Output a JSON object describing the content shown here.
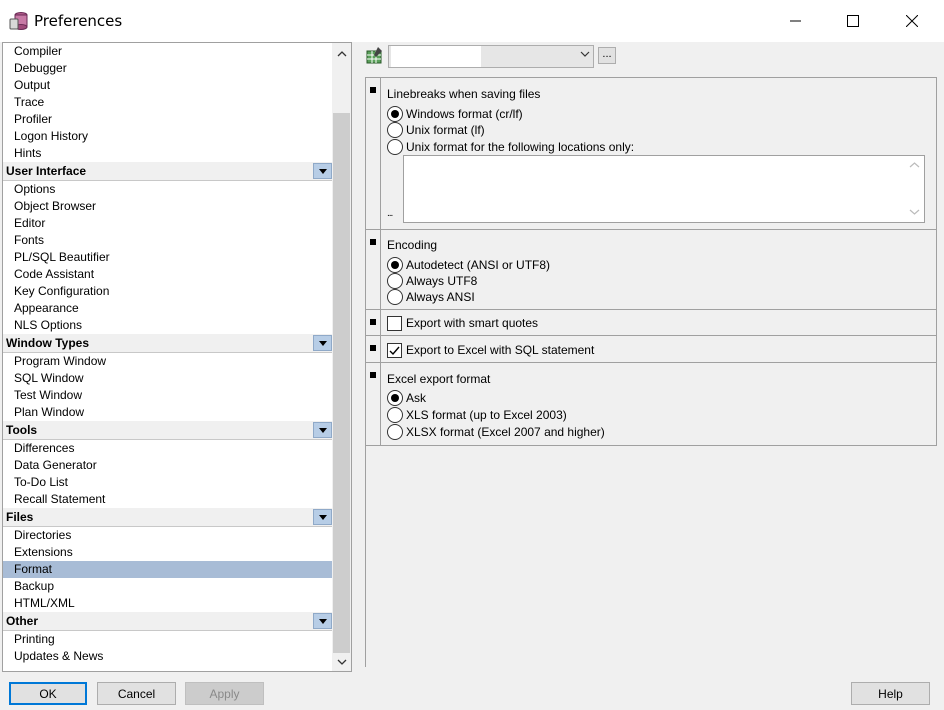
{
  "window": {
    "title": "Preferences",
    "icon": "database-icon"
  },
  "tree": {
    "groups": [
      {
        "header": null,
        "items": [
          "Compiler",
          "Debugger",
          "Output",
          "Trace",
          "Profiler",
          "Logon History",
          "Hints"
        ]
      },
      {
        "header": "User Interface",
        "items": [
          "Options",
          "Object Browser",
          "Editor",
          "Fonts",
          "PL/SQL Beautifier",
          "Code Assistant",
          "Key Configuration",
          "Appearance",
          "NLS Options"
        ]
      },
      {
        "header": "Window Types",
        "items": [
          "Program Window",
          "SQL Window",
          "Test Window",
          "Plan Window"
        ]
      },
      {
        "header": "Tools",
        "items": [
          "Differences",
          "Data Generator",
          "To-Do List",
          "Recall Statement"
        ]
      },
      {
        "header": "Files",
        "items": [
          "Directories",
          "Extensions",
          "Format",
          "Backup",
          "HTML/XML"
        ]
      },
      {
        "header": "Other",
        "items": [
          "Printing",
          "Updates & News"
        ]
      }
    ],
    "selected": "Format"
  },
  "linebreaks": {
    "title": "Linebreaks when saving files",
    "options": [
      "Windows format (cr/lf)",
      "Unix format (lf)",
      "Unix format for the following locations only:"
    ],
    "selected": 0,
    "dots": "..."
  },
  "encoding": {
    "title": "Encoding",
    "options": [
      "Autodetect (ANSI or UTF8)",
      "Always UTF8",
      "Always ANSI"
    ],
    "selected": 0
  },
  "smart_quotes": {
    "label": "Export with smart quotes",
    "checked": false
  },
  "excel_sql": {
    "label": "Export to Excel with SQL statement",
    "checked": true
  },
  "excel_format": {
    "title": "Excel export format",
    "options": [
      "Ask",
      "XLS format (up to Excel 2003)",
      "XLSX format (Excel 2007 and higher)"
    ],
    "selected": 0
  },
  "toolbar": {
    "ellipsis": "..."
  },
  "buttons": {
    "ok": "OK",
    "cancel": "Cancel",
    "apply": "Apply",
    "help": "Help"
  }
}
